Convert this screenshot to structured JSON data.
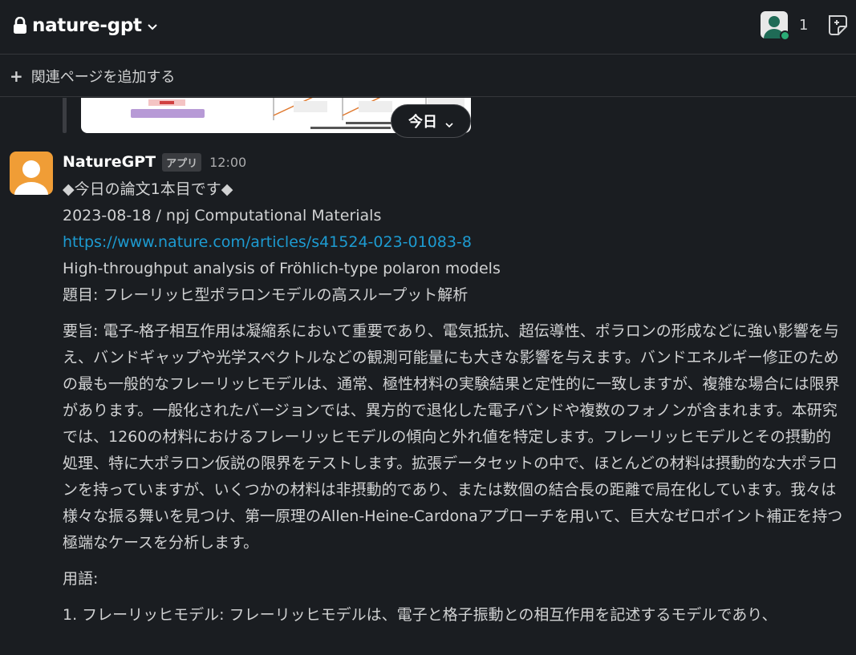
{
  "header": {
    "channel_name": "nature-gpt",
    "member_count": "1"
  },
  "bookmarks": {
    "add_label": "関連ページを追加する"
  },
  "date_divider": {
    "label": "今日"
  },
  "message": {
    "author": "NatureGPT",
    "badge": "アプリ",
    "time": "12:00",
    "lines": {
      "title": "◆今日の論文1本目です◆",
      "meta": "2023-08-18 / npj Computational Materials",
      "url": "https://www.nature.com/articles/s41524-023-01083-8",
      "paper_title": "High-throughput analysis of Fröhlich-type polaron models",
      "jp_title": "題目: フレーリッヒ型ポラロンモデルの高スループット解析"
    },
    "summary": "要旨: 電子-格子相互作用は凝縮系において重要であり、電気抵抗、超伝導性、ポラロンの形成などに強い影響を与え、バンドギャップや光学スペクトルなどの観測可能量にも大きな影響を与えます。バンドエネルギー修正のための最も一般的なフレーリッヒモデルは、通常、極性材料の実験結果と定性的に一致しますが、複雑な場合には限界があります。一般化されたバージョンでは、異方的で退化した電子バンドや複数のフォノンが含まれます。本研究では、1260の材料におけるフレーリッヒモデルの傾向と外れ値を特定します。フレーリッヒモデルとその摂動的処理、特に大ポラロン仮説の限界をテストします。拡張データセットの中で、ほとんどの材料は摂動的な大ポラロンを持っていますが、いくつかの材料は非摂動的であり、または数個の結合長の距離で局在化しています。我々は様々な振る舞いを見つけ、第一原理のAllen-Heine-Cardonaアプローチを用いて、巨大なゼロポイント補正を持つ極端なケースを分析します。",
    "terms_heading": "用語:",
    "term_1": "1. フレーリッヒモデル: フレーリッヒモデルは、電子と格子振動との相互作用を記述するモデルであり、"
  },
  "colors": {
    "background": "#1a1d21",
    "link": "#1d9bd1",
    "avatar_bg": "#f09d36",
    "online": "#2bac76"
  },
  "icons": [
    "lock-icon",
    "chevron-down-icon",
    "member-avatar-icon",
    "canvas-icon",
    "plus-icon",
    "bot-avatar-icon"
  ]
}
